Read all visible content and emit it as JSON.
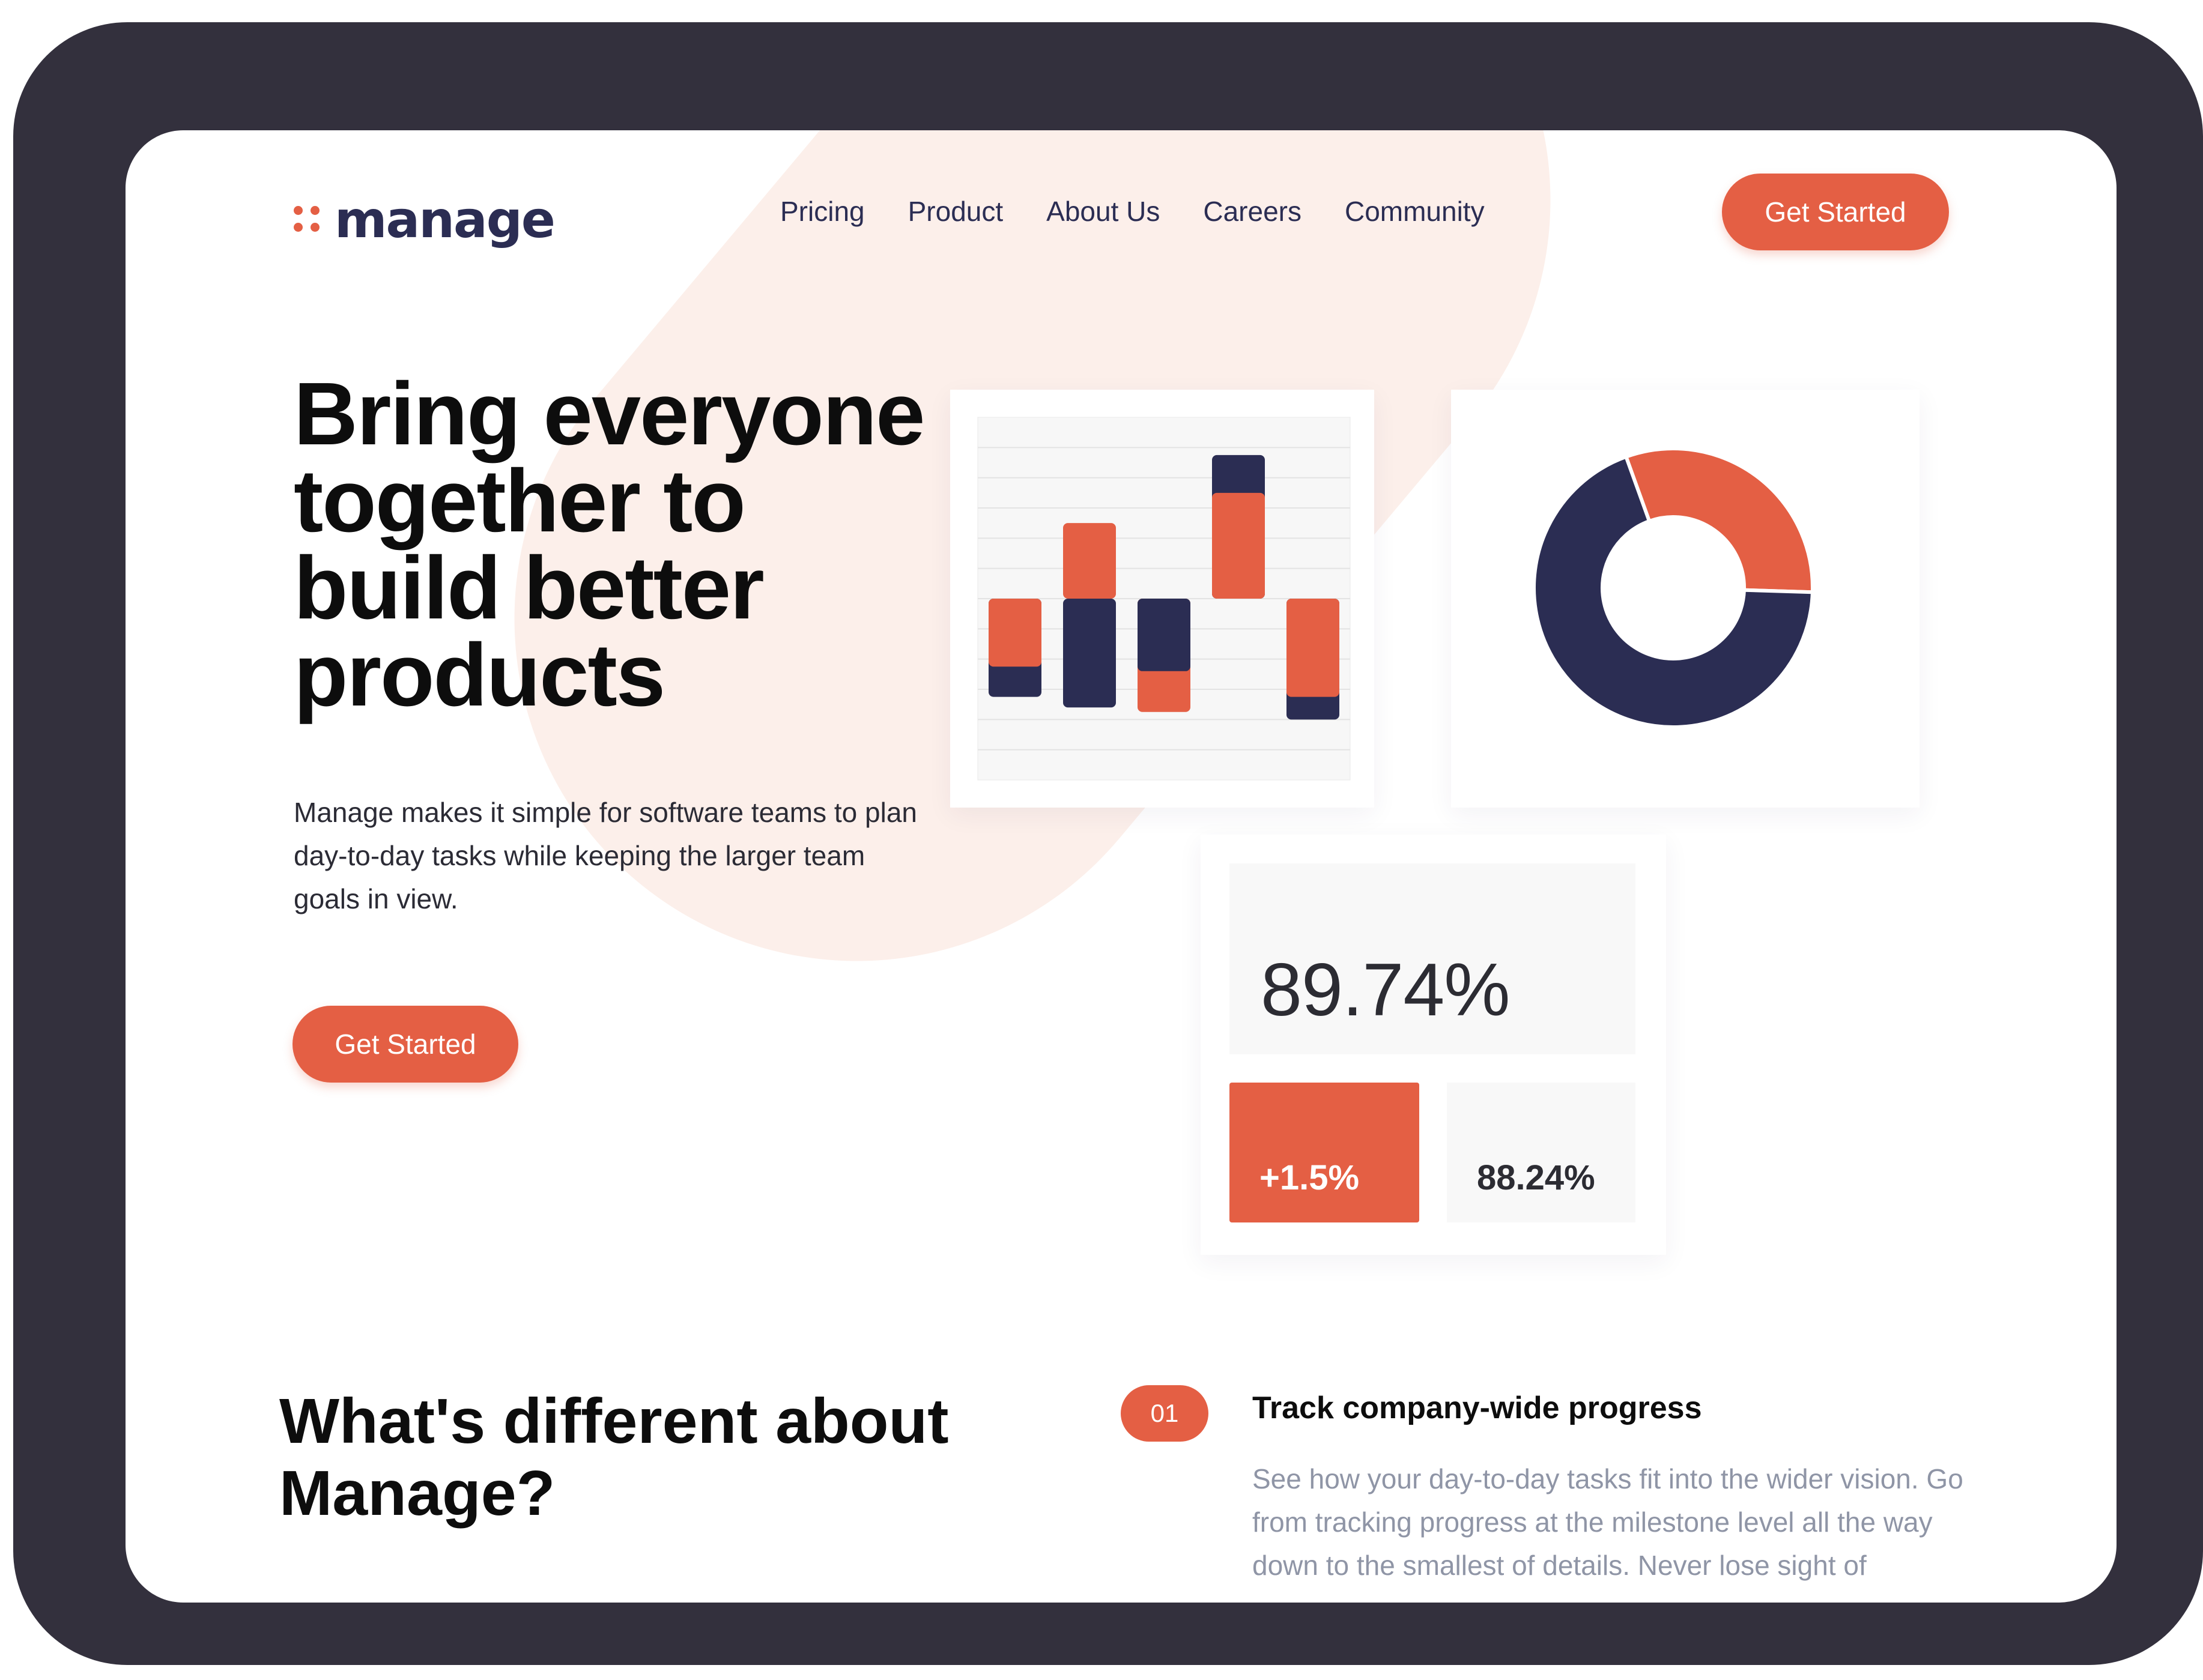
{
  "brand": {
    "name": "manage",
    "accent": "#e45f44",
    "navy": "#2b2d53"
  },
  "nav": {
    "items": [
      "Pricing",
      "Product",
      "About Us",
      "Careers",
      "Community"
    ],
    "cta": "Get Started"
  },
  "hero": {
    "title": "Bring everyone together to build better products",
    "description": "Manage makes it simple for software teams to plan day-to-day tasks while keeping the larger team goals in view.",
    "cta": "Get Started"
  },
  "stats": {
    "main": "89.74%",
    "change": "+1.5%",
    "secondary": "88.24%"
  },
  "section": {
    "title": "What's different about Manage?",
    "features": [
      {
        "number": "01",
        "title": "Track company-wide progress",
        "description": "See how your day-to-day tasks fit into the wider vision. Go from tracking progress at the milestone level all the way down to the smallest of details. Never lose sight of"
      }
    ]
  },
  "chart_data": [
    {
      "type": "bar",
      "series": [
        {
          "name": "",
          "color": "#e45f44",
          "values": [
            -0.45,
            0.5,
            -0.75,
            0.7,
            -0.65
          ]
        },
        {
          "name": "",
          "color": "#2b2d53",
          "values": [
            -0.65,
            -0.72,
            -0.48,
            0.95,
            -0.8
          ]
        }
      ],
      "ylim": [
        -1.2,
        1.2
      ],
      "grid": true
    },
    {
      "type": "pie",
      "donut": true,
      "slices": [
        {
          "value": 31,
          "color": "#e45f44"
        },
        {
          "value": 69,
          "color": "#2b2d53"
        }
      ]
    }
  ]
}
